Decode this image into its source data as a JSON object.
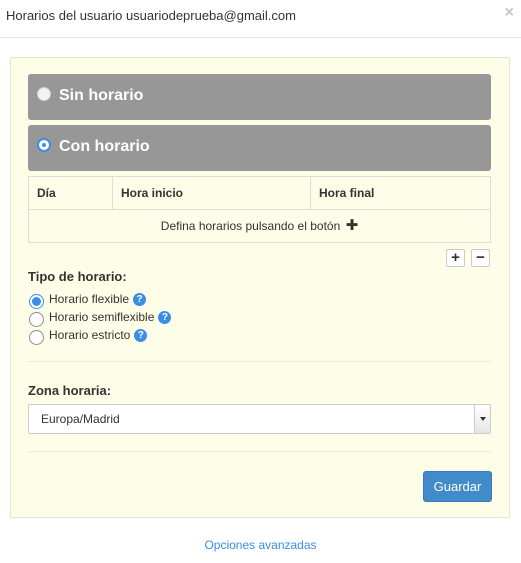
{
  "header": {
    "title": "Horarios del usuario usuariodeprueba@gmail.com",
    "close_label": "×"
  },
  "schedule_mode": {
    "options": [
      {
        "label": "Sin horario",
        "selected": false
      },
      {
        "label": "Con horario",
        "selected": true
      }
    ]
  },
  "table": {
    "columns": [
      "Día",
      "Hora inicio",
      "Hora final"
    ],
    "empty_message": "Defina horarios pulsando el botón",
    "empty_icon": "✚"
  },
  "row_buttons": {
    "add": "+",
    "remove": "−"
  },
  "schedule_type": {
    "label": "Tipo de horario:",
    "options": [
      {
        "label": "Horario flexible",
        "selected": true,
        "help": "?"
      },
      {
        "label": "Horario semiflexible",
        "selected": false,
        "help": "?"
      },
      {
        "label": "Horario estricto",
        "selected": false,
        "help": "?"
      }
    ]
  },
  "timezone": {
    "label": "Zona horaria:",
    "value": "Europa/Madrid"
  },
  "actions": {
    "save_label": "Guardar"
  },
  "footer": {
    "advanced_link": "Opciones avanzadas"
  },
  "colors": {
    "accent": "#428bca",
    "panel_bg": "#fefde8",
    "option_bar_bg": "#979797",
    "link": "#3a8ee6"
  }
}
